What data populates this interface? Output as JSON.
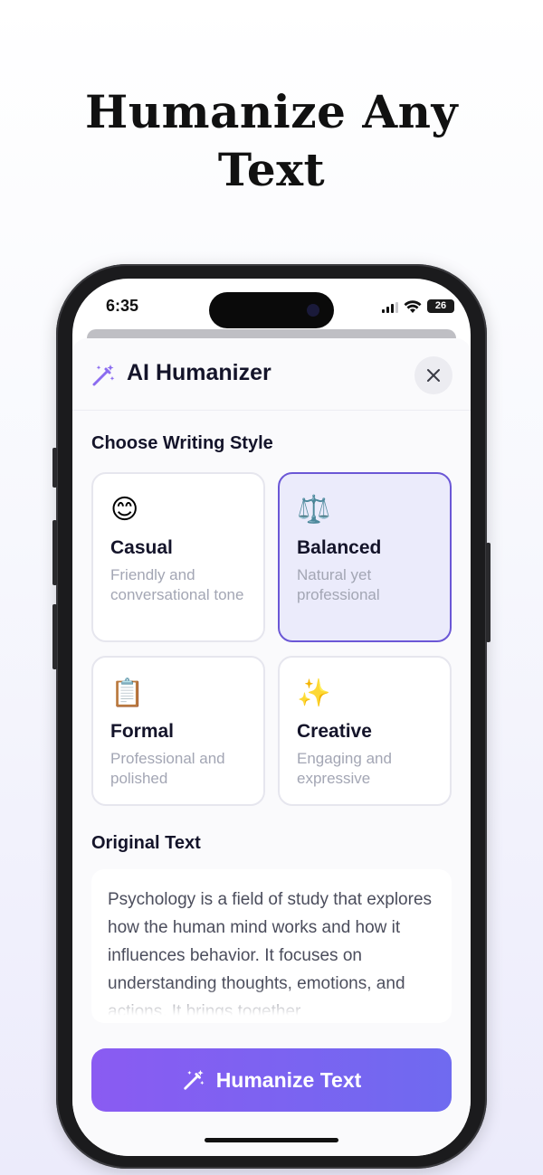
{
  "headline": {
    "line1": "Humanize Any",
    "line2": "Text"
  },
  "status_bar": {
    "time": "6:35",
    "battery": "26",
    "battery_fraction": 0.26
  },
  "sheet": {
    "title": "AI Humanizer",
    "close_icon": "close-icon",
    "title_icon": "magic-wand-icon"
  },
  "writing_style": {
    "section_title": "Choose Writing Style",
    "selected": "Balanced",
    "options": [
      {
        "emoji": "😊",
        "title": "Casual",
        "description": "Friendly and conversational tone"
      },
      {
        "emoji": "⚖️",
        "title": "Balanced",
        "description": "Natural yet professional"
      },
      {
        "emoji": "📋",
        "title": "Formal",
        "description": "Professional and polished"
      },
      {
        "emoji": "✨",
        "title": "Creative",
        "description": "Engaging and expressive"
      }
    ]
  },
  "original_text": {
    "section_title": "Original Text",
    "value": "Psychology is a field of study that explores how the human mind works and how it influences behavior. It focuses on understanding thoughts, emotions, and actions. It brings together"
  },
  "cta": {
    "label": "Humanize Text",
    "icon": "magic-wand-icon"
  },
  "colors": {
    "accent": "#6b57d6",
    "cta_start": "#8a5bf2",
    "cta_end": "#6f6af0",
    "selected_bg": "#ebebfb"
  }
}
